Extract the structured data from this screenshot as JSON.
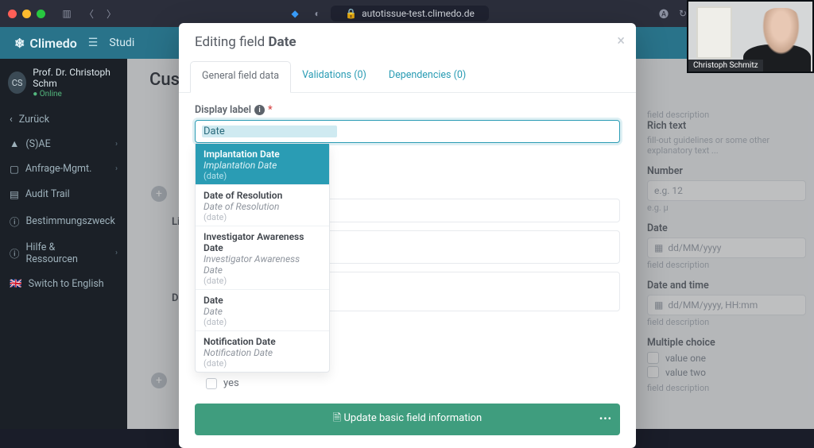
{
  "browser": {
    "url": "autotissue-test.climedo.de"
  },
  "app": {
    "brand": "Climedo",
    "headerItem": "Studi"
  },
  "user": {
    "initials": "CS",
    "name": "Prof. Dr. Christoph Schm",
    "status": "Online"
  },
  "nav": {
    "back": "Zurück",
    "items": [
      "(S)AE",
      "Anfrage-Mgmt.",
      "Audit Trail",
      "Bestimmungszweck",
      "Hilfe & Ressourcen"
    ],
    "switch": "Switch to English"
  },
  "page": {
    "title": "Custor",
    "sectionQ": "Liegt",
    "sectionDate": "Date"
  },
  "rightpanel": {
    "fd": "field description",
    "rich_title": "Rich text",
    "rich_hint": "fill-out guidelines or some other explanatory text ...",
    "number_title": "Number",
    "number_ph": "e.g. 12",
    "number_unit": "e.g. µ",
    "date_title": "Date",
    "date_ph": "dd/MM/yyyy",
    "dt_title": "Date and time",
    "dt_ph": "dd/MM/yyyy, HH:mm",
    "mc_title": "Multiple choice",
    "mc1": "value one",
    "mc2": "value two"
  },
  "modal": {
    "title_prefix": "Editing field ",
    "title_field": "Date",
    "tabs": {
      "general": "General field data",
      "val": "Validations (0)",
      "dep": "Dependencies (0)"
    },
    "display_label": "Display label",
    "display_value": "Date",
    "yes": "yes",
    "update": "Update basic field information",
    "options": [
      {
        "t": "Implantation Date",
        "s": "Implantation Date",
        "k": "(date)"
      },
      {
        "t": "Date of Resolution",
        "s": "Date of Resolution",
        "k": "(date)"
      },
      {
        "t": "Investigator Awareness Date",
        "s": "Investigator Awareness Date",
        "k": "(date)"
      },
      {
        "t": "Date",
        "s": "Date",
        "k": "(date)"
      },
      {
        "t": "Notification Date",
        "s": "Notification Date",
        "k": "(date)"
      }
    ]
  },
  "conference": {
    "name": "Christoph Schmitz"
  }
}
